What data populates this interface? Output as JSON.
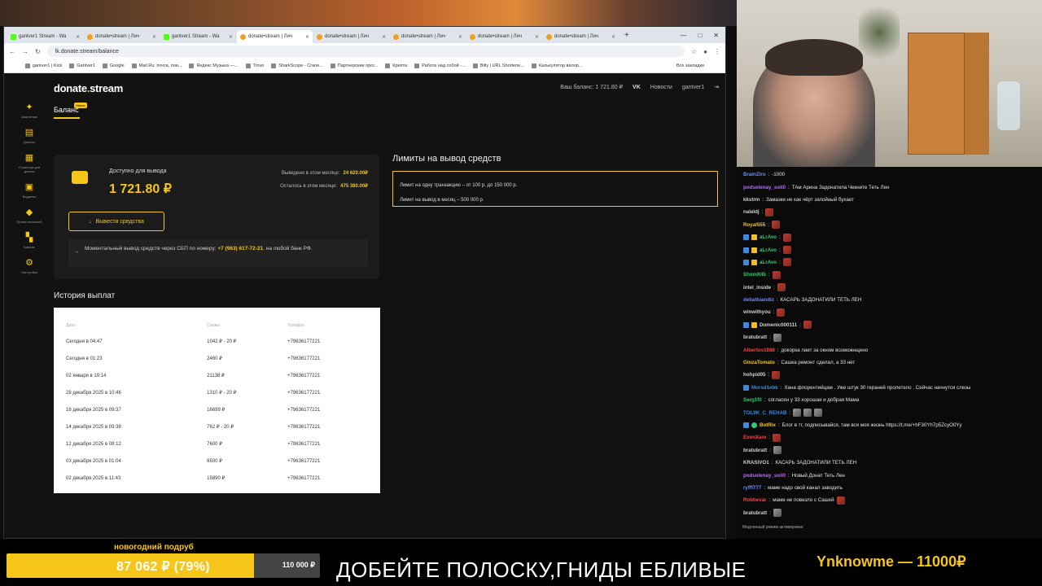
{
  "browser": {
    "tabs": [
      {
        "label": "gantver1 Stream - Wa",
        "fav": "k"
      },
      {
        "label": "donate•stream | Лич",
        "fav": "d"
      },
      {
        "label": "gantver1 Stream - Wa",
        "fav": "k"
      },
      {
        "label": "donate•stream | Лич",
        "fav": "d",
        "active": true
      },
      {
        "label": "donate•stream | Лич",
        "fav": "d"
      },
      {
        "label": "donate•stream | Лич",
        "fav": "d"
      },
      {
        "label": "donate•stream | Лич",
        "fav": "d"
      },
      {
        "label": "donate•stream | Лич",
        "fav": "d"
      }
    ],
    "url": "lk.donate.stream/balance",
    "bookmarks": [
      "gantver1 | Kick",
      "Gantver1",
      "Google",
      "Mail.Ru: почта, пои...",
      "Яндекс Музыка —...",
      "Trovo",
      "SharkScope - Crane...",
      "Партнерские прог...",
      "Крипта",
      "Работа над собой -...",
      "Bitly | URL Shortene...",
      "Калькулятор валор..."
    ],
    "all_bookmarks": "Все закладки"
  },
  "site": {
    "logo_a": "donate",
    "logo_b": ".",
    "logo_c": "stream",
    "section": "Баланс",
    "beta": "Новое",
    "header": {
      "balance": "Ваш баланс: 1 721.80 ₽",
      "vk": "VK",
      "news": "Новости",
      "user": "gantver1"
    },
    "sidebar": [
      {
        "label": "Аналитика",
        "icon": "rocket-icon"
      },
      {
        "label": "Донаты",
        "icon": "donate-icon"
      },
      {
        "label": "Страница для доната",
        "icon": "page-icon"
      },
      {
        "label": "Виджеты",
        "icon": "widgets-icon"
      },
      {
        "label": "Прием платежей",
        "icon": "payments-icon"
      },
      {
        "label": "Баланс",
        "icon": "balance-icon"
      },
      {
        "label": "Настройки",
        "icon": "gear-icon"
      }
    ],
    "available_label": "Доступно для вывода",
    "available_value": "1 721.80 ₽",
    "month_out_label": "Выведено в этом месяце:",
    "month_out_value": "24 620.00₽",
    "month_left_label": "Осталось в этом месяце:",
    "month_left_value": "475 380.00₽",
    "withdraw_button": "Вывести средства",
    "sbp_text_1": "Моментальный вывод средств через СБП по номеру:",
    "sbp_phone": "+7 (963) 617-72-21",
    "sbp_text_2": ", на любой банк РФ.",
    "limits_title": "Лимиты на вывод средств",
    "limit_1": "Лимит на одну транзакцию – от 100 р. до 150 000 р.",
    "limit_2": "Лимит на вывод в месяц – 500 000 р.",
    "history_title": "История выплат",
    "history_columns": [
      "Дата",
      "Сумма",
      "Телефон"
    ],
    "history_rows": [
      [
        "Сегодня в 04:47",
        "1042 ₽ - 20 ₽",
        "+79636177221"
      ],
      [
        "Сегодня в 01:23",
        "2460 ₽",
        "+79636177221"
      ],
      [
        "02 января в 19:14",
        "21138 ₽",
        "+79636177221"
      ],
      [
        "28 декабря 2025 в 10:46",
        "1310 ₽ - 20 ₽",
        "+79636177221"
      ],
      [
        "16 декабря 2025 в 09:37",
        "16699 ₽",
        "+79636177221"
      ],
      [
        "14 декабря 2025 в 09:38",
        "762 ₽ - 20 ₽",
        "+79636177221"
      ],
      [
        "12 декабря 2025 в 08:12",
        "7600 ₽",
        "+79636177221"
      ],
      [
        "03 декабря 2025 в 01:04",
        "6500 ₽",
        "+79636177221"
      ],
      [
        "02 декабря 2025 в 11:43",
        "15890 ₽",
        "+79636177221"
      ]
    ]
  },
  "chat": {
    "messages": [
      {
        "nick": "BrainZiro",
        "color": "#6a8cff",
        "text": "-1000"
      },
      {
        "nick": "podsolenay_soli0",
        "color": "#b56bff",
        "text": "ТАм Арина Задонатила Чекните Теть Лен"
      },
      {
        "nick": "kkstrm",
        "color": "#d0d0d0",
        "text": "Замазки не как чёрт запойный бухает"
      },
      {
        "nick": "naleldj",
        "color": "#d0d0d0",
        "text": "",
        "emotes": 1
      },
      {
        "nick": "Royal555",
        "color": "#f5c518",
        "text": "",
        "emotes": 1
      },
      {
        "nick": "aLrAvo",
        "color": "#2ecc71",
        "text": "",
        "emotes": 1,
        "badges": 2
      },
      {
        "nick": "aLrAvo",
        "color": "#2ecc71",
        "text": "",
        "emotes": 1,
        "badges": 2
      },
      {
        "nick": "aLrAvo",
        "color": "#2ecc71",
        "text": "",
        "emotes": 1,
        "badges": 2
      },
      {
        "nick": "Shmidt45",
        "color": "#2ecc71",
        "text": "",
        "emotes": 1
      },
      {
        "nick": "intel_inside",
        "color": "#d0d0d0",
        "text": "",
        "emotes": 1
      },
      {
        "nick": "debatluandiz",
        "color": "#6a8cff",
        "text": "КАСАРЬ ЗАДОНАТИЛИ ТЕТЬ ЛЕН"
      },
      {
        "nick": "winwithyou",
        "color": "#d0d0d0",
        "text": "",
        "emotes": 1
      },
      {
        "nick": "Domenic000111",
        "color": "#d0d0d0",
        "text": "",
        "emotes": 1,
        "badges": 2
      },
      {
        "nick": "bratubratt",
        "color": "#d0d0d0",
        "text": "",
        "emotes": 1
      },
      {
        "nick": "Albertos1888",
        "color": "#ff4040",
        "text": "докорка лает за окном возможнщено"
      },
      {
        "nick": "GinzaTomato",
        "color": "#f5c518",
        "text": "Сашка ремонт сделал, а 33 нет"
      },
      {
        "nick": "hohpid05",
        "color": "#d0d0d0",
        "text": "",
        "emotes": 1
      },
      {
        "nick": "Morsd1ebk",
        "color": "#3a8ae0",
        "text": "Хана флорентийцам . Уже штук 30 гераней пролетело . Сейчас начнутся слезы",
        "badges": 1
      },
      {
        "nick": "Serg1fil",
        "color": "#2ecc71",
        "text": "согласен у 33 хорошая и добрая Мама"
      },
      {
        "nick": "TOL9K_C_REHAB",
        "color": "#3a8ae0",
        "text": "",
        "emotes": 3
      },
      {
        "nick": "BotRix",
        "color": "#f5c518",
        "text": "Блог в тг, подписывайся, там вся моя жизнь https://t.me/+hF30Yh7p5ZcyO0Yy",
        "badges": 2
      },
      {
        "nick": "EvenXare",
        "color": "#ff4040",
        "text": "",
        "emotes": 1
      },
      {
        "nick": "bratubratt",
        "color": "#d0d0d0",
        "text": "",
        "emotes": 1
      },
      {
        "nick": "KRASIVO1",
        "color": "#d0d0d0",
        "text": "КАСАРЬ ЗАДОНАТИЛИ ТЕТЬ ЛЕН"
      },
      {
        "nick": "podsolenay_soli0",
        "color": "#b56bff",
        "text": "Новый Донат Теть Лен"
      },
      {
        "nick": "ryfff777",
        "color": "#6a8cff",
        "text": "маме надо свой канал заводить"
      },
      {
        "nick": "Robbevar",
        "color": "#ff4040",
        "text": "маме не повезло с Сашей",
        "emotes": 1
      },
      {
        "nick": "bratubratt",
        "color": "#d0d0d0",
        "text": "",
        "emotes": 1
      }
    ],
    "footer": "Медленный режим активирован"
  },
  "overlay": {
    "goal_title": "новогодний подруб",
    "goal_value": "87 062 ₽ (79%)",
    "goal_progress": 0.79,
    "goal_target": "110 000 ₽",
    "ticker": "ДОБЕЙТЕ ПОЛОСКУ,ГНИДЫ ЕБЛИВЫЕ",
    "last_donation": "Ynknowme — 11000₽"
  },
  "colors": {
    "accent": "#f5c518",
    "bg": "#121212"
  }
}
